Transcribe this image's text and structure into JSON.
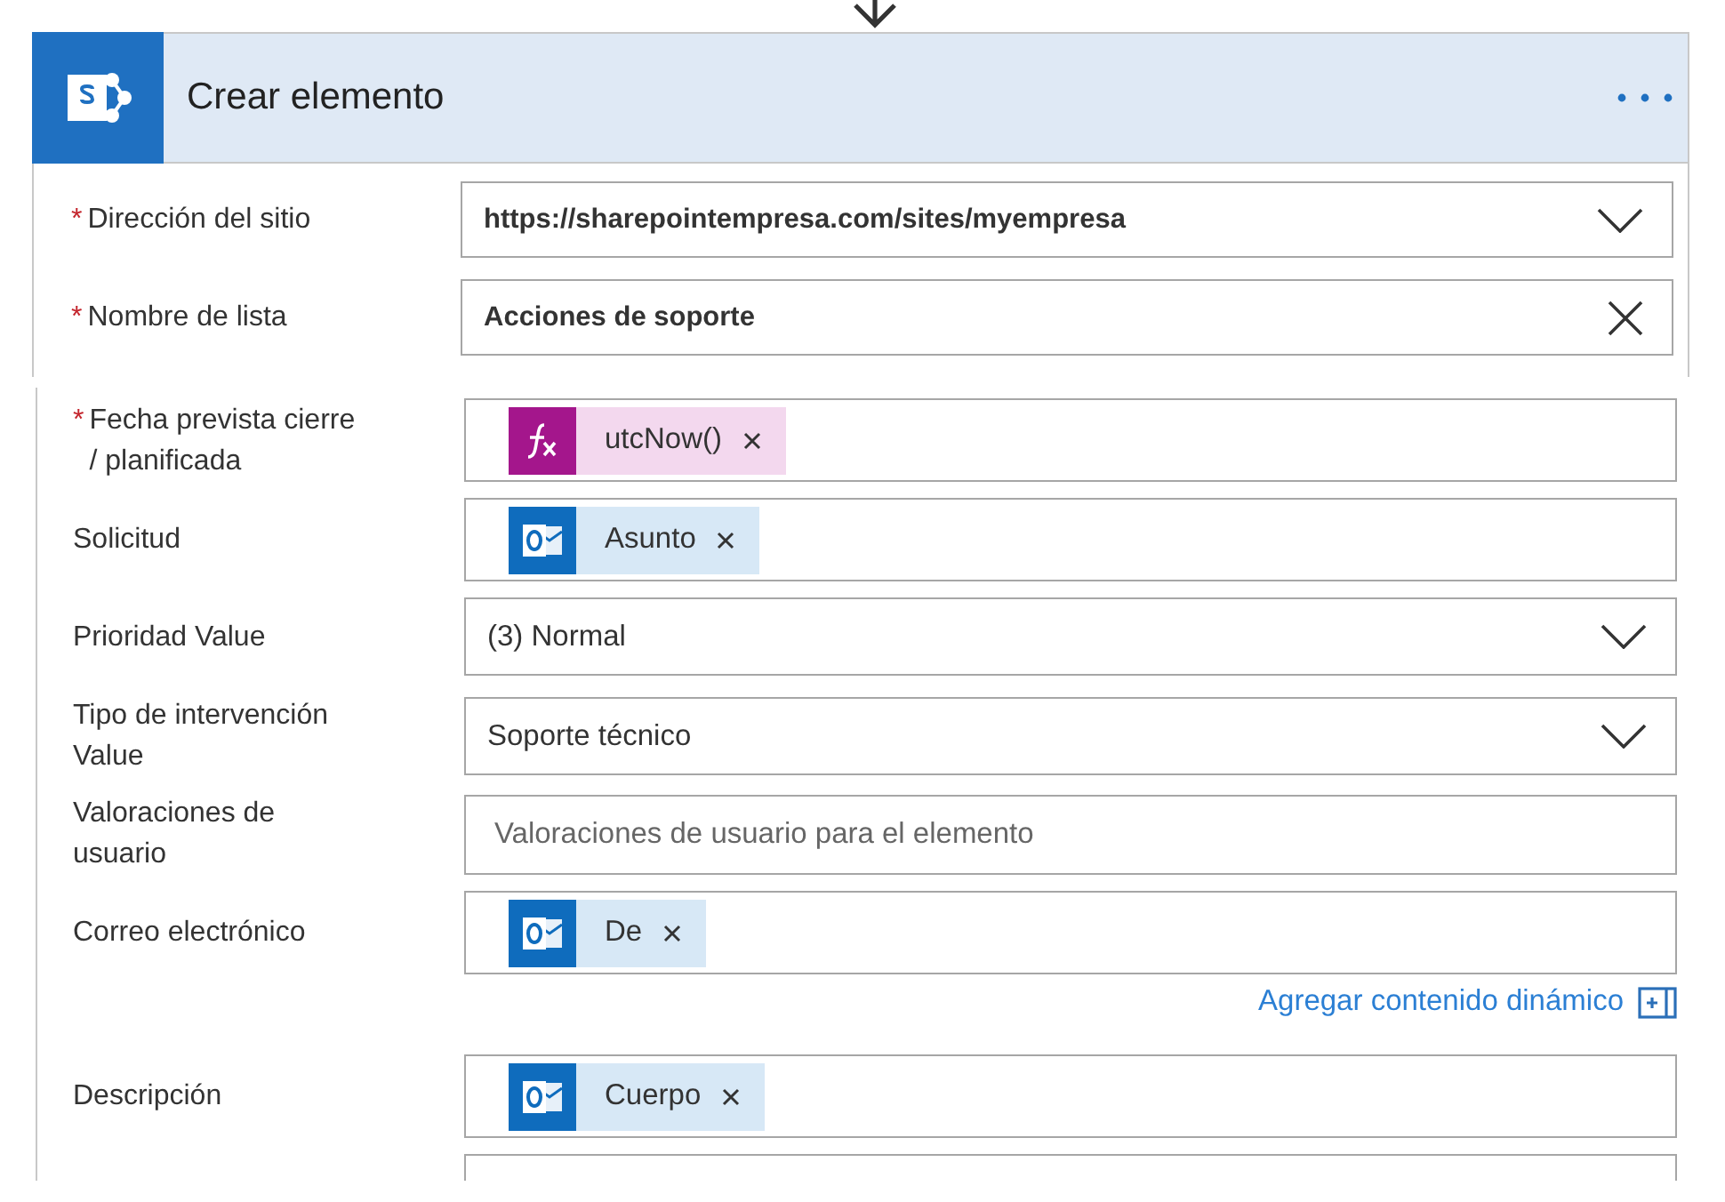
{
  "header": {
    "title": "Crear elemento"
  },
  "site_section": {
    "fields": [
      {
        "label": "Dirección del sitio",
        "required_mark": "*",
        "kind": "dropdown",
        "value": "https://sharepointempresa.com/sites/myempresa"
      },
      {
        "label": "Nombre de lista",
        "required_mark": "*",
        "kind": "clearable",
        "value": "Acciones de soporte"
      }
    ]
  },
  "details_section": {
    "fields": [
      {
        "label": "Fecha prevista cierre / planificada",
        "required_mark": "*",
        "kind": "tokens",
        "tokens": [
          {
            "kind": "expression",
            "text": "utcNow()"
          }
        ]
      },
      {
        "label": "Solicitud",
        "kind": "tokens",
        "tokens": [
          {
            "kind": "outlook",
            "text": "Asunto"
          }
        ]
      },
      {
        "label": "Prioridad Value",
        "kind": "dropdown",
        "value": "(3) Normal"
      },
      {
        "label": "Tipo de intervención Value",
        "kind": "dropdown",
        "value": "Soporte técnico"
      },
      {
        "label": "Valoraciones de usuario",
        "kind": "text",
        "placeholder": "Valoraciones de usuario para el elemento"
      },
      {
        "label": "Correo electrónico",
        "kind": "tokens",
        "tokens": [
          {
            "kind": "outlook",
            "text": "De"
          }
        ],
        "dynamic_link": "Agregar contenido dinámico"
      },
      {
        "label": "Descripción",
        "kind": "tokens",
        "tokens": [
          {
            "kind": "outlook",
            "text": "Cuerpo"
          }
        ]
      },
      {
        "kind": "text"
      }
    ]
  }
}
